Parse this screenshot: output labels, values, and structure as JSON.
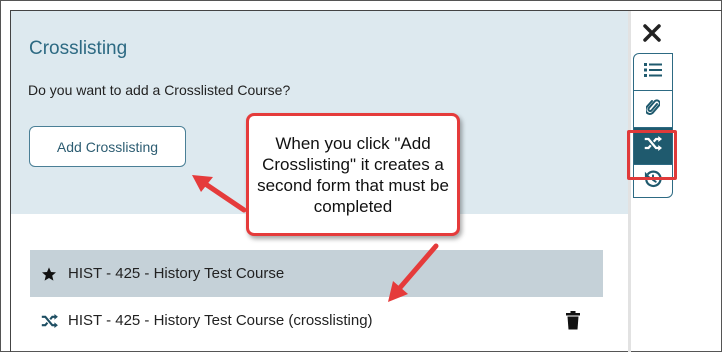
{
  "crosslisting": {
    "title": "Crosslisting",
    "question": "Do you want to add a Crosslisted Course?",
    "add_button_label": "Add Crosslisting"
  },
  "callout": {
    "text": "When you click \"Add Crosslisting\" it creates a second form that must be completed"
  },
  "courses": [
    {
      "icon": "star-icon",
      "label": "HIST - 425 - History Test Course",
      "selected": true
    },
    {
      "icon": "shuffle-icon",
      "label": "HIST - 425 - History Test Course (crosslisting)",
      "selected": false,
      "action_icon": "trash-icon"
    }
  ],
  "toolbar": {
    "close_icon": "close-icon",
    "tools": [
      {
        "icon": "list-icon",
        "active": false
      },
      {
        "icon": "paperclip-icon",
        "active": false
      },
      {
        "icon": "shuffle-icon",
        "active": true
      },
      {
        "icon": "history-icon",
        "active": false
      }
    ]
  },
  "colors": {
    "panel_bg": "#dde9ef",
    "accent": "#2d6a83",
    "active_tool": "#1f5a6e",
    "selected_row": "#c5d1d8",
    "annotation_red": "#e53b3b"
  }
}
